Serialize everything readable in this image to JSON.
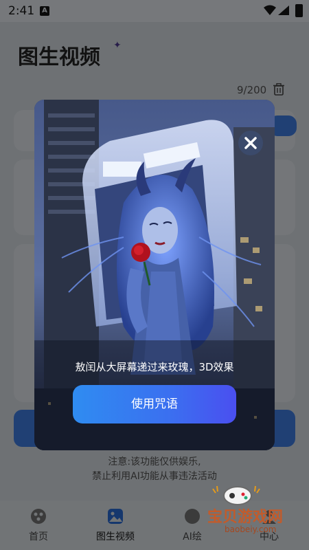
{
  "status_bar": {
    "time": "2:41",
    "notification_icon": "A"
  },
  "page": {
    "title": "图生视频",
    "counter": "9/200"
  },
  "notice": {
    "line1": "注意:该功能仅供娱乐,",
    "line2": "禁止利用AI功能从事违法活动"
  },
  "nav": {
    "items": [
      {
        "label": "首页"
      },
      {
        "label": "图生视频"
      },
      {
        "label": "AI绘"
      },
      {
        "label": "中心"
      }
    ]
  },
  "modal": {
    "prompt_text": "敖闰从大屏幕递过来玫瑰，3D效果",
    "cta_label": "使用咒语"
  },
  "watermark": {
    "text": "宝贝游戏网",
    "url": "baobeiy.com"
  },
  "colors": {
    "accent_blue": "#2f7cf0",
    "cta_end": "#4a4ff0",
    "watermark": "#c25b2b"
  }
}
